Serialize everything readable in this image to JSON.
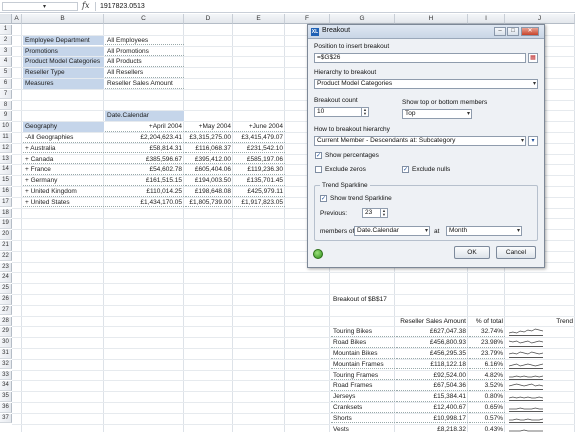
{
  "formula_bar": {
    "name_box": "",
    "fx": "fx",
    "content": "1917823.0513"
  },
  "columns": [
    "A",
    "B",
    "C",
    "D",
    "E",
    "F",
    "G",
    "H",
    "I",
    "J"
  ],
  "rows": [
    "1",
    "2",
    "3",
    "4",
    "5",
    "6",
    "7",
    "8",
    "9",
    "10",
    "11",
    "12",
    "13",
    "14",
    "15",
    "16",
    "17",
    "18",
    "19",
    "20",
    "21",
    "22",
    "23",
    "24",
    "25",
    "26",
    "27",
    "28",
    "29",
    "30",
    "31",
    "32",
    "33",
    "34",
    "35",
    "36",
    "37"
  ],
  "filters": [
    {
      "label": "Employee Department",
      "value": "All Employees"
    },
    {
      "label": "Promotions",
      "value": "All Promotions"
    },
    {
      "label": "Product Model Categories",
      "value": "All Products"
    },
    {
      "label": "Reseller Type",
      "value": "All Resellers"
    },
    {
      "label": "Measures",
      "value": "Reseller Sales Amount"
    }
  ],
  "pivot": {
    "column_dim": "Date.Calendar",
    "row_dim": "Geography",
    "months": [
      "+April 2004",
      "+May 2004",
      "+June 2004"
    ],
    "rows": [
      {
        "name": "-All Geographies",
        "values": [
          "£2,204,623.41",
          "£3,315,275.00",
          "£3,415,479.07"
        ]
      },
      {
        "name": "+  Australia",
        "values": [
          "£58,814.31",
          "£116,068.37",
          "£231,542.10"
        ]
      },
      {
        "name": "+  Canada",
        "values": [
          "£385,596.67",
          "£395,412.00",
          "£585,197.06"
        ]
      },
      {
        "name": "+  France",
        "values": [
          "£54,602.78",
          "£605,404.06",
          "£119,236.30"
        ]
      },
      {
        "name": "+  Germany",
        "values": [
          "£161,515.15",
          "£194,003.50",
          "£135,701.45"
        ]
      },
      {
        "name": "+  United Kingdom",
        "values": [
          "£110,014.25",
          "£198,648.08",
          "£425,979.11"
        ]
      },
      {
        "name": "+  United States",
        "values": [
          "£1,434,170.05",
          "£1,805,739.00",
          "£1,917,823.05"
        ]
      }
    ]
  },
  "breakout": {
    "title": "Breakout of $B$17",
    "headers": [
      "Reseller Sales Amount",
      "% of total",
      "Trend"
    ],
    "rows": [
      {
        "name": "Touring Bikes",
        "amount": "£627,047.38",
        "pct": "32.74%",
        "trend": [
          3,
          4,
          3,
          5,
          4,
          6,
          5,
          7,
          6,
          5
        ]
      },
      {
        "name": "Road Bikes",
        "amount": "£456,800.93",
        "pct": "23.98%",
        "trend": [
          6,
          5,
          6,
          4,
          5,
          6,
          4,
          5,
          6,
          5
        ]
      },
      {
        "name": "Mountain Bikes",
        "amount": "£456,295.35",
        "pct": "23.79%",
        "trend": [
          4,
          5,
          4,
          6,
          5,
          4,
          6,
          5,
          4,
          5
        ]
      },
      {
        "name": "Mountain Frames",
        "amount": "£118,122.18",
        "pct": "6.16%",
        "trend": [
          3,
          4,
          5,
          3,
          4,
          5,
          4,
          3,
          4,
          5
        ]
      },
      {
        "name": "Touring Frames",
        "amount": "£92,524.00",
        "pct": "4.82%",
        "trend": [
          3,
          3,
          4,
          3,
          4,
          3,
          3,
          4,
          3,
          4
        ]
      },
      {
        "name": "Road Frames",
        "amount": "£67,504.36",
        "pct": "3.52%",
        "trend": [
          4,
          5,
          6,
          5,
          4,
          5,
          6,
          4,
          5,
          4
        ]
      },
      {
        "name": "Jerseys",
        "amount": "£15,384.41",
        "pct": "0.80%",
        "trend": [
          3,
          4,
          3,
          4,
          3,
          4,
          3,
          3,
          4,
          3
        ]
      },
      {
        "name": "Cranksets",
        "amount": "£12,400.67",
        "pct": "0.65%",
        "trend": [
          3,
          3,
          3,
          4,
          3,
          3,
          3,
          4,
          3,
          3
        ]
      },
      {
        "name": "Shorts",
        "amount": "£10,998.17",
        "pct": "0.57%",
        "trend": [
          3,
          3,
          4,
          3,
          3,
          4,
          3,
          3,
          3,
          4
        ]
      },
      {
        "name": "Vests",
        "amount": "£8,218.32",
        "pct": "0.43%",
        "trend": [
          3,
          3,
          3,
          3,
          4,
          3,
          3,
          3,
          3,
          3
        ]
      }
    ]
  },
  "dialog": {
    "title": "Breakout",
    "position_label": "Position to insert breakout",
    "position_value": "=$G$26",
    "hierarchy_label": "Hierarchy to breakout",
    "hierarchy_value": "Product Model Categories",
    "count_label": "Breakout count",
    "count_value": "10",
    "topbottom_label": "Show top or bottom members",
    "topbottom_value": "Top",
    "how_label": "How to breakout hierarchy",
    "how_value": "Current Member - Descendants at: Subcategory",
    "show_pct": "Show percentages",
    "exclude_zeros": "Exclude zeros",
    "exclude_nulls": "Exclude nulls",
    "trend_group": "Trend Sparkline",
    "show_trend": "Show trend Sparkline",
    "previous_label": "Previous:",
    "previous_value": "23",
    "members_label": "members of",
    "members_value": "Date.Calendar",
    "at_label": "at",
    "at_value": "Month",
    "ok": "OK",
    "cancel": "Cancel"
  }
}
